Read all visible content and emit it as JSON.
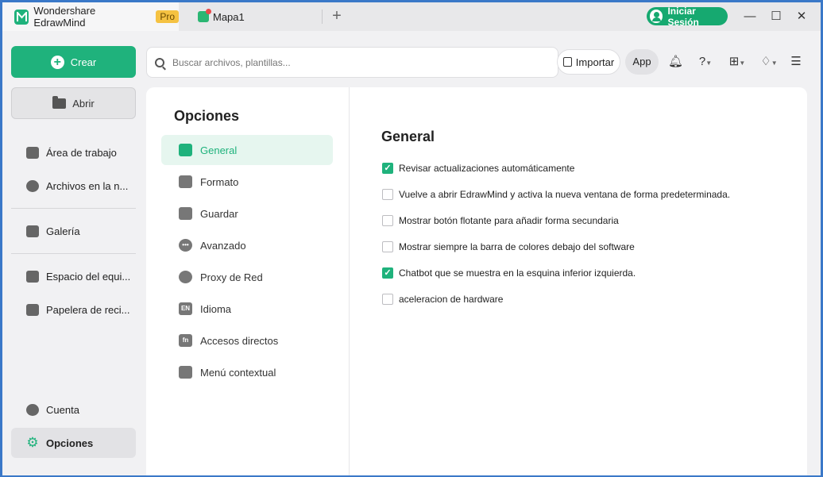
{
  "titlebar": {
    "app_name": "Wondershare EdrawMind",
    "pro_badge": "Pro",
    "doc_tab": "Mapa1",
    "new_tab": "+",
    "login_label": "Iniciar Sesión"
  },
  "window_controls": {
    "minimize": "—",
    "maximize": "☐",
    "close": "✕"
  },
  "sidebar": {
    "create_label": "Crear",
    "open_label": "Abrir",
    "items": [
      {
        "label": "Área de trabajo",
        "icon": "workspace-icon"
      },
      {
        "label": "Archivos en la n...",
        "icon": "cloud-icon"
      },
      {
        "label": "Galería",
        "icon": "gallery-icon"
      },
      {
        "label": "Espacio del equi...",
        "icon": "team-space-icon"
      },
      {
        "label": "Papelera de reci...",
        "icon": "trash-icon"
      }
    ],
    "account_label": "Cuenta",
    "options_label": "Opciones"
  },
  "search": {
    "placeholder": "Buscar archivos, plantillas..."
  },
  "toolbar": {
    "import_label": "Importar",
    "app_label": "App",
    "icons": [
      "bell-icon",
      "help-icon",
      "apps-grid-icon",
      "theme-shirt-icon",
      "outline-toggle-icon"
    ]
  },
  "options_nav": {
    "title": "Opciones",
    "items": [
      {
        "label": "General",
        "icon": "general-settings-icon",
        "active": true
      },
      {
        "label": "Formato",
        "icon": "format-icon",
        "active": false
      },
      {
        "label": "Guardar",
        "icon": "save-icon",
        "active": false
      },
      {
        "label": "Avanzado",
        "icon": "advanced-icon",
        "active": false
      },
      {
        "label": "Proxy de Red",
        "icon": "proxy-icon",
        "active": false
      },
      {
        "label": "Idioma",
        "icon": "language-icon",
        "active": false
      },
      {
        "label": "Accesos directos",
        "icon": "shortcuts-icon",
        "active": false
      },
      {
        "label": "Menú contextual",
        "icon": "context-menu-icon",
        "active": false
      }
    ]
  },
  "general": {
    "title": "General",
    "options": [
      {
        "label": "Revisar actualizaciones automáticamente",
        "checked": true
      },
      {
        "label": "Vuelve a abrir EdrawMind y activa la nueva ventana de forma predeterminada.",
        "checked": false
      },
      {
        "label": "Mostrar botón flotante para añadir forma secundaria",
        "checked": false
      },
      {
        "label": "Mostrar siempre la barra de colores debajo del software",
        "checked": false
      },
      {
        "label": "Chatbot que se muestra en la esquina inferior izquierda.",
        "checked": true
      },
      {
        "label": "aceleracion de hardware",
        "checked": false
      }
    ]
  },
  "colors": {
    "accent": "#1fb27c",
    "pro_badge": "#f5c242",
    "active_bg": "#e6f6ef"
  }
}
